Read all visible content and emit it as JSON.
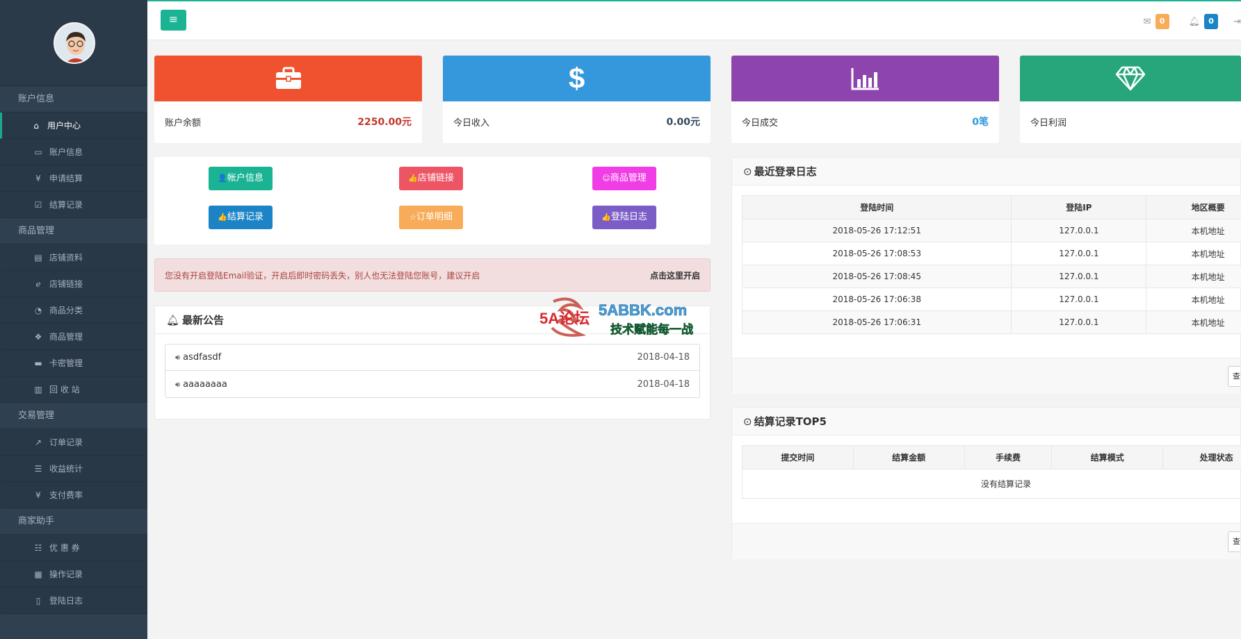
{
  "sidebar": {
    "sections": [
      {
        "title": "账户信息",
        "items": [
          {
            "label": "用户中心",
            "icon": "home-icon",
            "active": true
          },
          {
            "label": "账户信息",
            "icon": "map-icon"
          },
          {
            "label": "申请结算",
            "icon": "yen-icon"
          },
          {
            "label": "结算记录",
            "icon": "calendar-check-icon"
          }
        ]
      },
      {
        "title": "商品管理",
        "items": [
          {
            "label": "店铺资料",
            "icon": "card-list-icon"
          },
          {
            "label": "店铺链接",
            "icon": "ie-icon"
          },
          {
            "label": "商品分类",
            "icon": "dashboard-icon"
          },
          {
            "label": "商品管理",
            "icon": "cubes-icon"
          },
          {
            "label": "卡密管理",
            "icon": "credit-card-icon"
          },
          {
            "label": "回 收 站",
            "icon": "trash-icon"
          }
        ]
      },
      {
        "title": "交易管理",
        "items": [
          {
            "label": "订单记录",
            "icon": "line-chart-icon"
          },
          {
            "label": "收益统计",
            "icon": "list-icon"
          },
          {
            "label": "支付费率",
            "icon": "yen-icon"
          }
        ]
      },
      {
        "title": "商家助手",
        "items": [
          {
            "label": "优 惠 券",
            "icon": "list-alt-icon"
          },
          {
            "label": "操作记录",
            "icon": "calendar-icon"
          },
          {
            "label": "登陆日志",
            "icon": "file-icon"
          }
        ]
      }
    ]
  },
  "topbar": {
    "mail_count": "0",
    "bell_count": "0",
    "mail_color": "#f8ac59",
    "bell_color": "#1c84c6"
  },
  "stats": [
    {
      "label": "账户余额",
      "value": "2250.00元",
      "color": "#f0512f",
      "value_color": "#c0392b",
      "icon": "briefcase-icon"
    },
    {
      "label": "今日收入",
      "value": "0.00元",
      "color": "#3598dc",
      "value_color": "#34495e",
      "icon": "dollar-icon"
    },
    {
      "label": "今日成交",
      "value": "0笔",
      "color": "#8e44ad",
      "value_color": "#3598dc",
      "icon": "bar-chart-icon"
    },
    {
      "label": "今日利润",
      "value": "",
      "color": "#26a67a",
      "value_color": "#333",
      "icon": "diamond-icon"
    }
  ],
  "quick_buttons": [
    {
      "label": "帐户信息",
      "icon": "👤",
      "color": "#1ab394"
    },
    {
      "label": "店铺链接",
      "icon": "👍",
      "color": "#ed5565"
    },
    {
      "label": "商品管理",
      "icon": "☺",
      "color": "#f03de6"
    },
    {
      "label": "结算记录",
      "icon": "👍",
      "color": "#1c84c6"
    },
    {
      "label": "订单明细",
      "icon": "☆",
      "color": "#f8ac59"
    },
    {
      "label": "登陆日志",
      "icon": "👍",
      "color": "#7a5dc7"
    }
  ],
  "alert": {
    "text": "您没有开启登陆Email验证，开启后即时密码丢失，别人也无法登陆您账号，建议开启",
    "link": "点击这里开启"
  },
  "notices": {
    "title": "最新公告",
    "items": [
      {
        "title": "asdfasdf",
        "date": "2018-04-18"
      },
      {
        "title": "aaaaaaaa",
        "date": "2018-04-18"
      }
    ]
  },
  "login_log": {
    "title": "最近登录日志",
    "headers": [
      "登陆时间",
      "登陆IP",
      "地区概要"
    ],
    "rows": [
      [
        "2018-05-26 17:12:51",
        "127.0.0.1",
        "本机地址"
      ],
      [
        "2018-05-26 17:08:53",
        "127.0.0.1",
        "本机地址"
      ],
      [
        "2018-05-26 17:08:45",
        "127.0.0.1",
        "本机地址"
      ],
      [
        "2018-05-26 17:06:38",
        "127.0.0.1",
        "本机地址"
      ],
      [
        "2018-05-26 17:06:31",
        "127.0.0.1",
        "本机地址"
      ]
    ],
    "more_label": "查"
  },
  "settle_top": {
    "title": "结算记录TOP5",
    "headers": [
      "提交时间",
      "结算金额",
      "手续费",
      "结算模式",
      "处理状态"
    ],
    "empty": "没有结算记录",
    "more_label": "查"
  },
  "watermark": {
    "logo": "5A论坛",
    "domain": "5ABBK.com",
    "slogan": "技术赋能每一战"
  }
}
